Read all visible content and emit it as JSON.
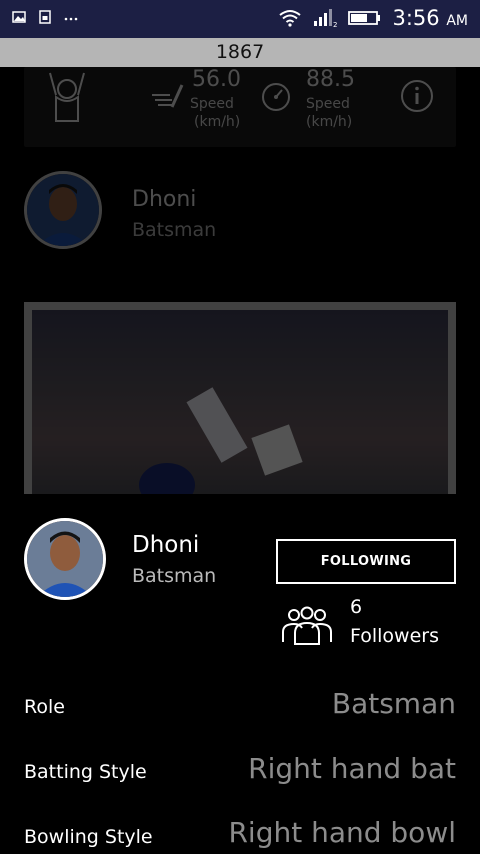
{
  "status_bar": {
    "time": "3:56",
    "ampm": "AM",
    "icons": [
      "image-icon",
      "sim-card-icon",
      "more-dots-icon",
      "wifi-icon",
      "signal-icon",
      "battery-icon"
    ]
  },
  "counter": "1867",
  "background": {
    "stats": [
      {
        "value": "56.0",
        "unit_label": "Speed",
        "unit": "(km/h)",
        "icon": "bowling-speed-icon"
      },
      {
        "value": "88.5",
        "unit_label": "Speed",
        "unit": "(km/h)",
        "icon": "speedometer-icon"
      }
    ],
    "player_name": "Dhoni",
    "player_role": "Batsman"
  },
  "profile": {
    "name": "Dhoni",
    "role": "Batsman",
    "follow_button": "FOLLOWING",
    "followers_count": "6",
    "followers_label": "Followers"
  },
  "details": [
    {
      "label": "Role",
      "value": "Batsman"
    },
    {
      "label": "Batting Style",
      "value": "Right hand bat"
    },
    {
      "label": "Bowling Style",
      "value": "Right hand bowl"
    }
  ],
  "colors": {
    "status_bar": "#1c1f44",
    "counter_bar": "#b5b5b5",
    "value_text": "#8c8c8c"
  }
}
